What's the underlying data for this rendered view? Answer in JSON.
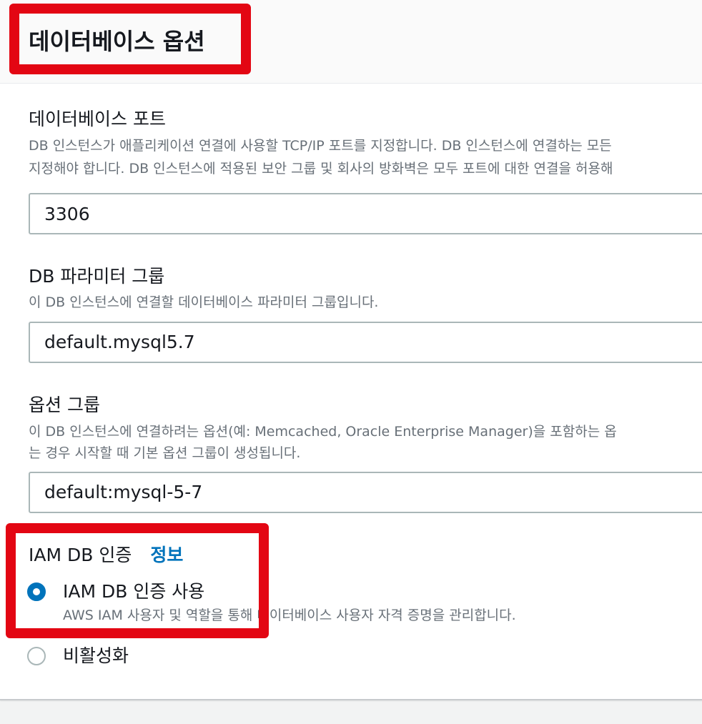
{
  "section": {
    "title": "데이터베이스 옵션"
  },
  "port": {
    "label": "데이터베이스 포트",
    "desc_line1": "DB 인스턴스가 애플리케이션 연결에 사용할 TCP/IP 포트를 지정합니다. DB 인스턴스에 연결하는 모든",
    "desc_line2": "지정해야 합니다. DB 인스턴스에 적용된 보안 그룹 및 회사의 방화벽은 모두 포트에 대한 연결을 허용해",
    "value": "3306"
  },
  "parameter_group": {
    "label": "DB 파라미터 그룹",
    "desc": "이 DB 인스턴스에 연결할 데이터베이스 파라미터 그룹입니다.",
    "value": "default.mysql5.7"
  },
  "option_group": {
    "label": "옵션 그룹",
    "desc_line1": "이 DB 인스턴스에 연결하려는 옵션(예: Memcached, Oracle Enterprise Manager)을 포함하는 옵",
    "desc_line2": "는 경우 시작할 때 기본 옵션 그룹이 생성됩니다.",
    "value": "default:mysql-5-7"
  },
  "iam_auth": {
    "label": "IAM DB 인증",
    "info_link": "정보",
    "options": [
      {
        "label": "IAM DB 인증 사용",
        "desc": "AWS IAM 사용자 및 역할을 통해 데이터베이스 사용자 자격 증명을 관리합니다.",
        "selected": true
      },
      {
        "label": "비활성화",
        "selected": false
      }
    ]
  },
  "colors": {
    "highlight": "#e30613",
    "link": "#0073bb",
    "radio_selected": "#0073bb"
  }
}
